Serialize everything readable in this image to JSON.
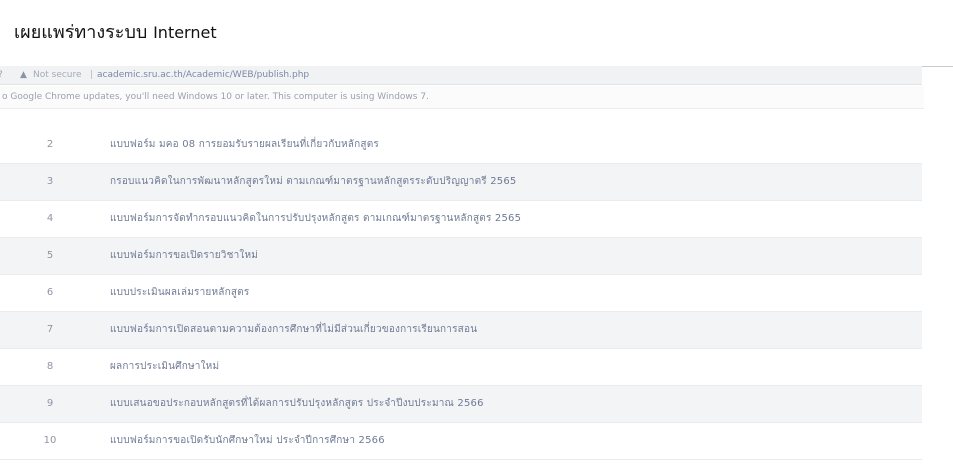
{
  "heading": {
    "thai": "เผยแพร่ทางระบบ",
    "latin": "Internet"
  },
  "browser": {
    "nav_glyph": "?",
    "security_label": "Not secure",
    "separator": "|",
    "url": "academic.sru.ac.th/Academic/WEB/publish.php"
  },
  "notice": {
    "text": "o Google Chrome updates, you'll need Windows 10 or later. This computer is using Windows 7."
  },
  "table": {
    "rows": [
      {
        "num": "2",
        "title": "แบบฟอร์ม มคอ 08 การยอมรับรายผลเรียนที่เกี่ยวกับหลักสูตร"
      },
      {
        "num": "3",
        "title": "กรอบแนวคิดในการพัฒนาหลักสูตรใหม่ ตามเกณฑ์มาตรฐานหลักสูตรระดับปริญญาตรี 2565"
      },
      {
        "num": "4",
        "title": "แบบฟอร์มการจัดทำกรอบแนวคิดในการปรับปรุงหลักสูตร ตามเกณฑ์มาตรฐานหลักสูตร 2565"
      },
      {
        "num": "5",
        "title": "แบบฟอร์มการขอเปิดรายวิชาใหม่"
      },
      {
        "num": "6",
        "title": "แบบประเมินผลเล่มรายหลักสูตร"
      },
      {
        "num": "7",
        "title": "แบบฟอร์มการเปิดสอนตามความต้องการศึกษาที่ไม่มีส่วนเกี่ยวของการเรียนการสอน"
      },
      {
        "num": "8",
        "title": "ผลการประเมินศึกษาใหม่"
      },
      {
        "num": "9",
        "title": "แบบเสนอขอประกอบหลักสูตรที่ได้ผลการปรับปรุงหลักสูตร ประจำปีงบประมาณ 2566"
      },
      {
        "num": "10",
        "title": "แบบฟอร์มการขอเปิดรับนักศึกษาใหม่ ประจำปีการศึกษา 2566"
      }
    ]
  }
}
